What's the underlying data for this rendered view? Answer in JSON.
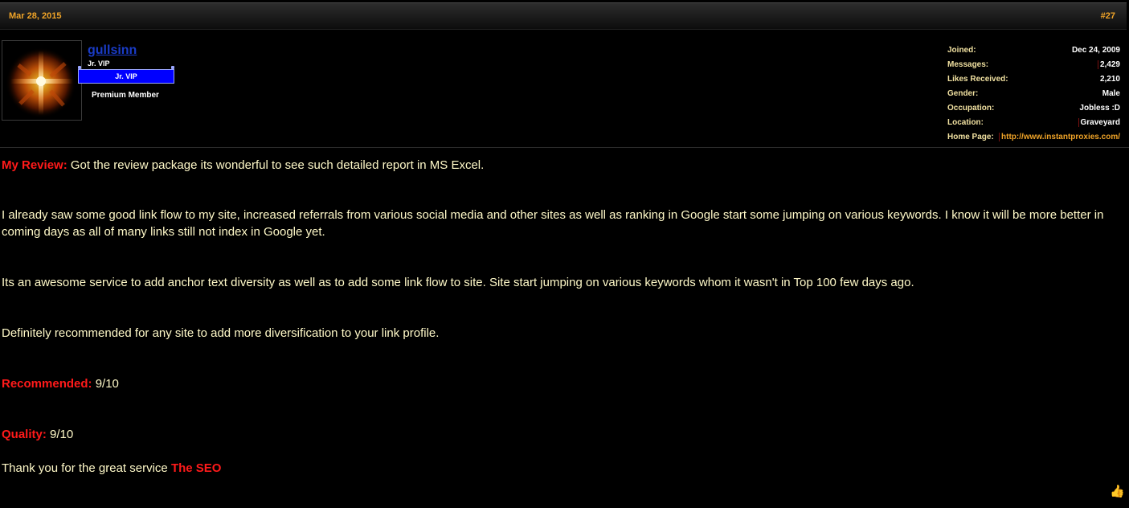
{
  "post": {
    "date": "Mar 28, 2015",
    "number": "#27"
  },
  "user": {
    "name": "gullsinn",
    "title": "Jr. VIP",
    "rank_badge": "Jr. VIP",
    "member_type": "Premium Member",
    "avatar_icon": "glowing-cross-icon",
    "stats": [
      {
        "label": "Joined:",
        "value": "Dec 24, 2009"
      },
      {
        "label": "Messages:",
        "value": "2,429"
      },
      {
        "label": "Likes Received:",
        "value": "2,210"
      },
      {
        "label": "Gender:",
        "value": "Male"
      },
      {
        "label": "Occupation:",
        "value": "Jobless :D"
      },
      {
        "label": "Location:",
        "value": "Graveyard"
      },
      {
        "label": "Home Page:",
        "value": "http://www.instantproxies.com/"
      }
    ]
  },
  "message": {
    "review_label": "My Review:",
    "review_text": " Got the review package its wonderful to see such detailed report in MS Excel.",
    "para2": "I already saw some good link flow to my site, increased referrals from various social media and other sites as well as ranking in Google start some jumping on various keywords. I know it will be more better in coming days as all of many links still not index in Google yet.",
    "para3": "Its an awesome service to add anchor text diversity as well as to add some link flow to site. Site start jumping on various keywords whom it wasn't in Top 100 few days ago.",
    "para4": "Definitely recommended for any site to add more diversification to your link profile.",
    "recommended_label": "Recommended:",
    "recommended_value": " 9/10",
    "quality_label": "Quality:",
    "quality_value": " 9/10",
    "thanks_text": "Thank you for the great service ",
    "thanks_target": "The SEO"
  },
  "colors": {
    "accent": "#f0a428",
    "highlight_red": "#ff1a1a",
    "body_text": "#fff9c8",
    "username": "#1a3cc8",
    "badge": "#0000ff"
  },
  "like_icon": "thumbs-up-icon"
}
